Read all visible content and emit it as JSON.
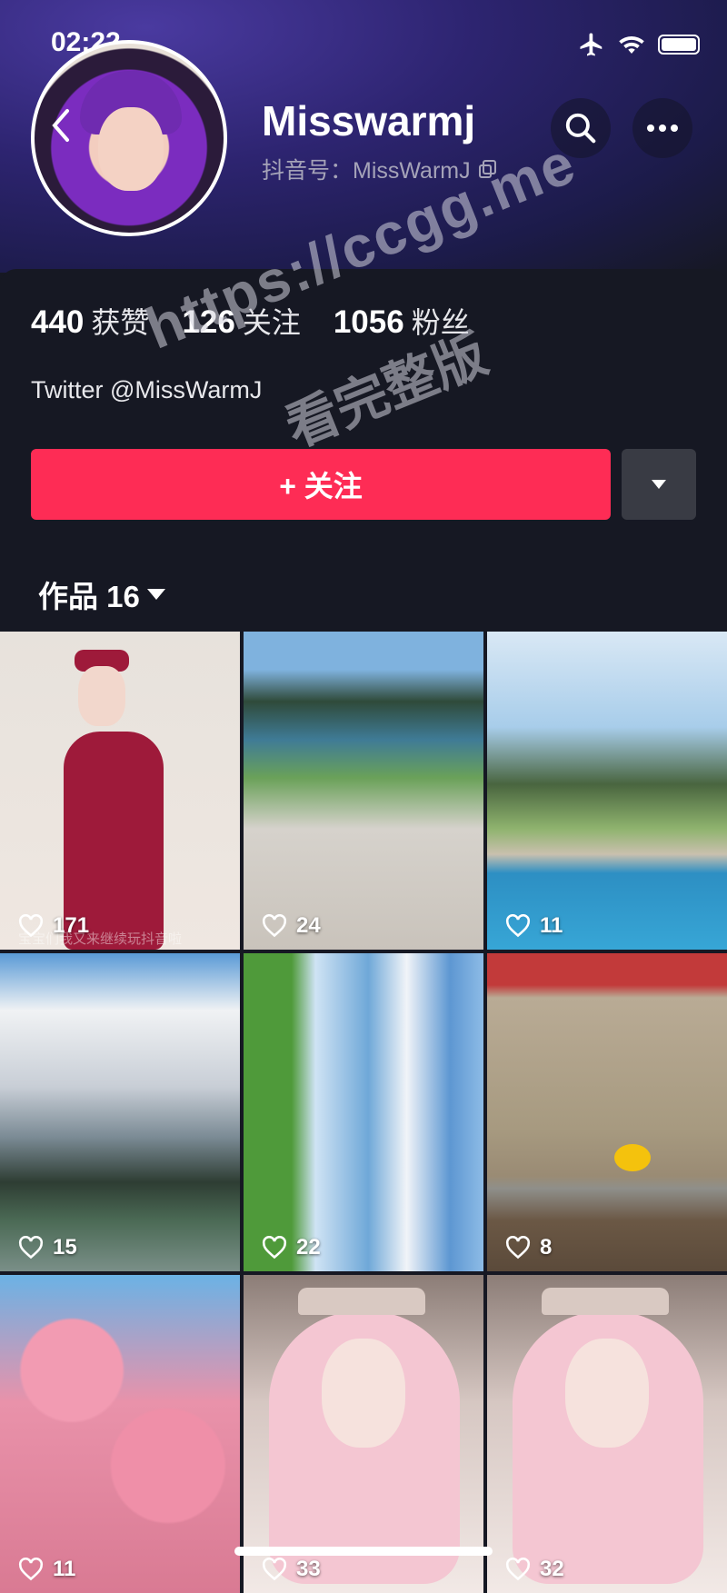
{
  "status_bar": {
    "time": "02:22"
  },
  "profile": {
    "username": "Misswarmj",
    "douyin_id": "抖音号：MissWarmJ",
    "bio": "Twitter @MissWarmJ"
  },
  "stats": [
    {
      "num": "440",
      "label": "获赞"
    },
    {
      "num": "126",
      "label": "关注"
    },
    {
      "num": "1056",
      "label": "粉丝"
    }
  ],
  "actions": {
    "follow_label": "+ 关注"
  },
  "tabs": {
    "works_label": "作品 16"
  },
  "watermark": {
    "line1": "https://ccgg.me",
    "line2": "看完整版"
  },
  "tiles": [
    {
      "likes": "171",
      "caption": "宝宝们我又来继续玩抖音啦"
    },
    {
      "likes": "24"
    },
    {
      "likes": "11"
    },
    {
      "likes": "15"
    },
    {
      "likes": "22"
    },
    {
      "likes": "8"
    },
    {
      "likes": "11"
    },
    {
      "likes": "33"
    },
    {
      "likes": "32"
    }
  ],
  "colors": {
    "accent": "#fe2c55",
    "background": "#161823"
  }
}
